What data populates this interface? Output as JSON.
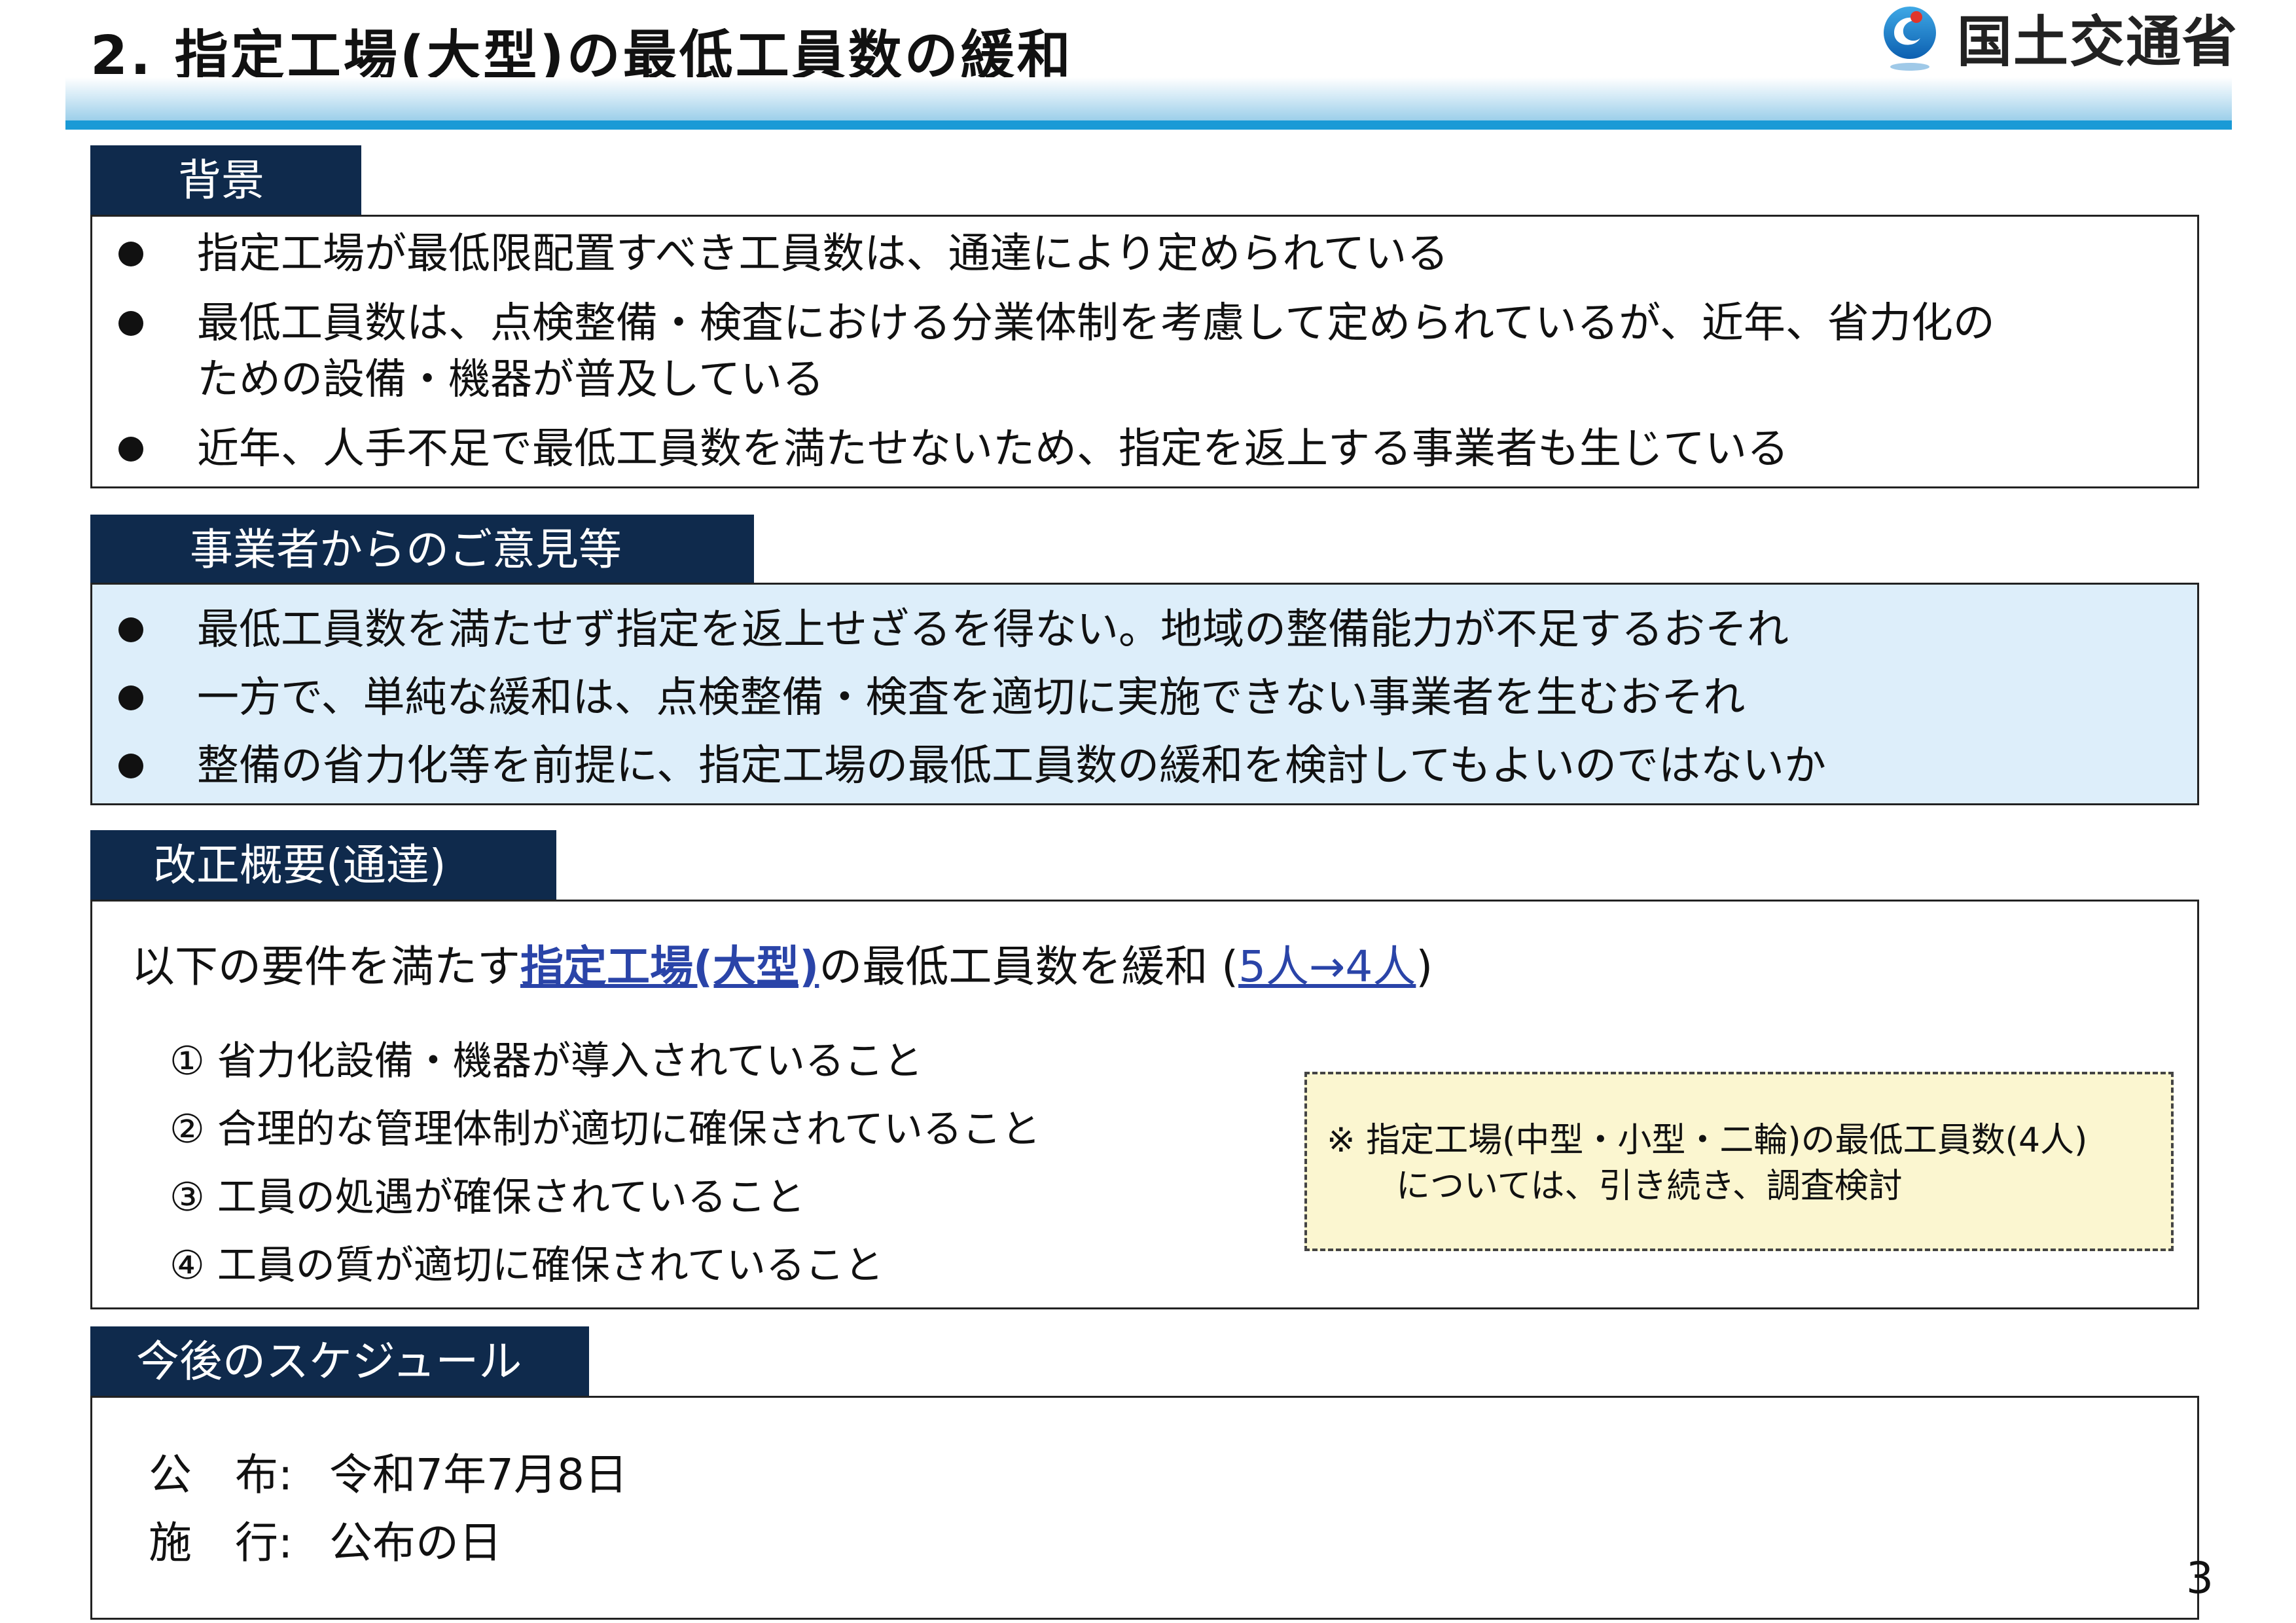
{
  "header": {
    "title": "2. 指定工場(大型)の最低工員数の緩和",
    "ministry": "国土交通省"
  },
  "sections": {
    "background": {
      "label": "背景",
      "bullets": [
        "指定工場が最低限配置すべき工員数は、通達により定められている",
        "最低工員数は、点検整備・検査における分業体制を考慮して定められているが、近年、省力化の",
        "ための設備・機器が普及している",
        "近年、人手不足で最低工員数を満たせないため、指定を返上する事業者も生じている"
      ]
    },
    "opinions": {
      "label": "事業者からのご意見等",
      "bullets": [
        "最低工員数を満たせず指定を返上せざるを得ない。地域の整備能力が不足するおそれ",
        "一方で、単純な緩和は、点検整備・検査を適切に実施できない事業者を生むおそれ",
        "整備の省力化等を前提に、指定工場の最低工員数の緩和を検討してもよいのではないか"
      ]
    },
    "revision": {
      "label": "改正概要(通達)",
      "lead_prefix": "以下の要件を満たす",
      "lead_highlight": "指定工場(大型)",
      "lead_middle": "の最低工員数を緩和 (",
      "lead_change": "5人→4人",
      "lead_suffix": ")",
      "requirements": [
        "① 省力化設備・機器が導入されていること",
        "② 合理的な管理体制が適切に確保されていること",
        "③ 工員の処遇が確保されていること",
        "④ 工員の質が適切に確保されていること"
      ],
      "note_line1": "※  指定工場(中型・小型・二輪)の最低工員数(4人)",
      "note_line2": "については、引き続き、調査検討"
    },
    "schedule": {
      "label": "今後のスケジュール",
      "items": [
        {
          "label": "公　布:",
          "value": "令和7年7月8日"
        },
        {
          "label": "施　行:",
          "value": "公布の日"
        }
      ]
    }
  },
  "page_number": "3",
  "colors": {
    "tab_bg": "#0f2a4c",
    "header_rule": "#1a9ad6",
    "opinions_bg": "#ddeefa",
    "note_bg": "#fbf6d0",
    "highlight": "#2a44a8"
  },
  "icons": {
    "logo": "mlit-logo-icon",
    "bullet": "bullet-dot-icon"
  }
}
